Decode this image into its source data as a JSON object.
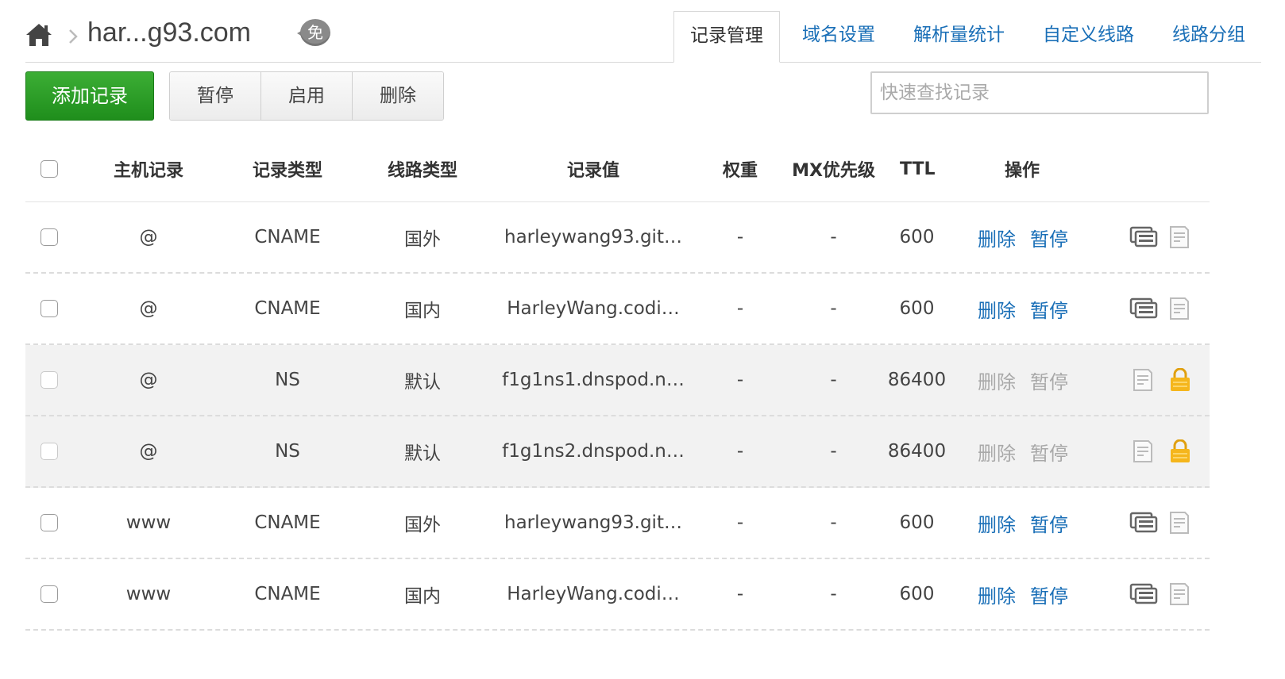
{
  "breadcrumb": {
    "domain": "har...g93.com",
    "badge": "免"
  },
  "tabs": [
    {
      "label": "记录管理",
      "active": true
    },
    {
      "label": "域名设置",
      "active": false
    },
    {
      "label": "解析量统计",
      "active": false
    },
    {
      "label": "自定义线路",
      "active": false
    },
    {
      "label": "线路分组",
      "active": false
    }
  ],
  "toolbar": {
    "add_label": "添加记录",
    "pause_label": "暂停",
    "enable_label": "启用",
    "delete_label": "删除",
    "search_placeholder": "快速查找记录"
  },
  "columns": {
    "host": "主机记录",
    "type": "记录类型",
    "line": "线路类型",
    "value": "记录值",
    "weight": "权重",
    "mx": "MX优先级",
    "ttl": "TTL",
    "ops": "操作"
  },
  "rows": [
    {
      "host": "@",
      "type": "CNAME",
      "line": "国外",
      "value": "harleywang93.git…",
      "weight": "-",
      "mx": "-",
      "ttl": "600",
      "op_delete": "删除",
      "op_pause": "暂停",
      "locked": false
    },
    {
      "host": "@",
      "type": "CNAME",
      "line": "国内",
      "value": "HarleyWang.codi…",
      "weight": "-",
      "mx": "-",
      "ttl": "600",
      "op_delete": "删除",
      "op_pause": "暂停",
      "locked": false
    },
    {
      "host": "@",
      "type": "NS",
      "line": "默认",
      "value": "f1g1ns1.dnspod.n…",
      "weight": "-",
      "mx": "-",
      "ttl": "86400",
      "op_delete": "删除",
      "op_pause": "暂停",
      "locked": true
    },
    {
      "host": "@",
      "type": "NS",
      "line": "默认",
      "value": "f1g1ns2.dnspod.n…",
      "weight": "-",
      "mx": "-",
      "ttl": "86400",
      "op_delete": "删除",
      "op_pause": "暂停",
      "locked": true
    },
    {
      "host": "www",
      "type": "CNAME",
      "line": "国外",
      "value": "harleywang93.git…",
      "weight": "-",
      "mx": "-",
      "ttl": "600",
      "op_delete": "删除",
      "op_pause": "暂停",
      "locked": false
    },
    {
      "host": "www",
      "type": "CNAME",
      "line": "国内",
      "value": "HarleyWang.codi…",
      "weight": "-",
      "mx": "-",
      "ttl": "600",
      "op_delete": "删除",
      "op_pause": "暂停",
      "locked": false
    }
  ],
  "icons": {
    "home": "home-icon",
    "remark": "remark-icon",
    "note": "note-icon",
    "lock": "lock-icon"
  },
  "colors": {
    "primary_green": "#23961f",
    "link_blue": "#1a6fb7",
    "disabled_gray": "#a9a9a9",
    "lock_yellow": "#f5b61c",
    "locked_row_bg": "#f2f2f2"
  }
}
